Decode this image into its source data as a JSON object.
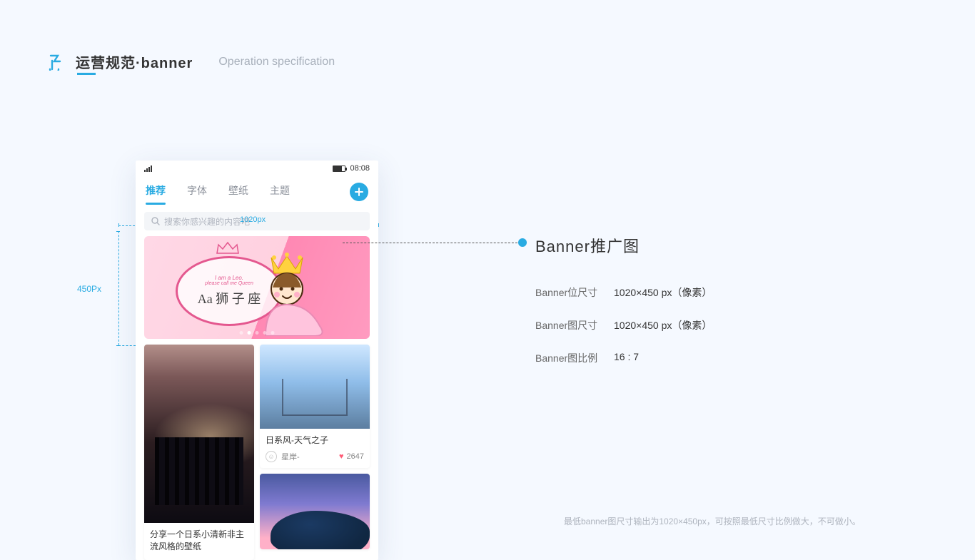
{
  "header": {
    "title_cn": "运营规范·banner",
    "title_en": "Operation specification"
  },
  "phone": {
    "time": "08:08",
    "tabs": [
      "推荐",
      "字体",
      "壁纸",
      "主题"
    ],
    "active_tab_index": 0,
    "search_placeholder": "搜索你感兴趣的内容吧",
    "banner": {
      "line1": "I am a Leo.",
      "line2": "please call me Queen",
      "line3": "Aa 狮 子 座"
    },
    "dim_width_label": "1020px",
    "card_left_title": "分享一个日系小清新非主流风格的壁纸",
    "card_r1_title": "日系风-天气之子",
    "card_r1_user": "星岸-",
    "card_r1_likes": "2647"
  },
  "dims": {
    "height_label": "450Px"
  },
  "spec": {
    "heading": "Banner推广图",
    "rows": [
      {
        "label": "Banner位尺寸",
        "value": "1020×450 px（像素）"
      },
      {
        "label": "Banner图尺寸",
        "value": "1020×450 px（像素）"
      },
      {
        "label": "Banner图比例",
        "value": "16 : 7"
      }
    ]
  },
  "footnote": "最低banner图尺寸输出为1020×450px，可按照最低尺寸比例做大，不可做小。"
}
